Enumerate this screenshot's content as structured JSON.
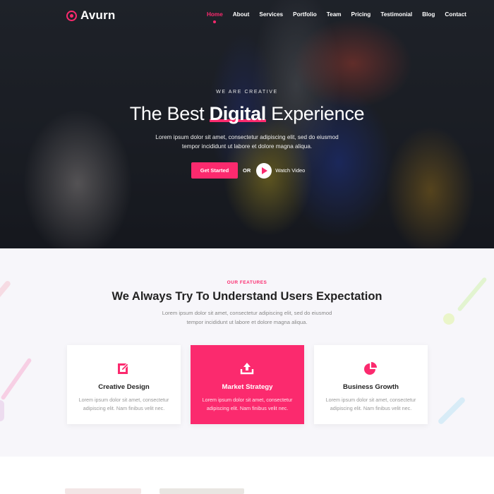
{
  "brand": {
    "name": "Avurn",
    "accent": "#fb2a6e",
    "logo_icon": "circle-target-icon"
  },
  "nav": {
    "items": [
      {
        "label": "Home",
        "active": true
      },
      {
        "label": "About",
        "active": false
      },
      {
        "label": "Services",
        "active": false
      },
      {
        "label": "Portfolio",
        "active": false
      },
      {
        "label": "Team",
        "active": false
      },
      {
        "label": "Pricing",
        "active": false
      },
      {
        "label": "Testimonial",
        "active": false
      },
      {
        "label": "Blog",
        "active": false
      },
      {
        "label": "Contact",
        "active": false
      }
    ]
  },
  "hero": {
    "eyebrow": "WE ARE CREATIVE",
    "title_pre": "The Best ",
    "title_bold": "Digital",
    "title_post": " Experience",
    "description": "Lorem ipsum dolor sit amet, consectetur adipiscing elit, sed do eiusmod tempor incididunt ut labore et dolore magna aliqua.",
    "cta_label": "Get Started",
    "or_label": "OR",
    "video_label": "Watch Video",
    "play_icon": "play-icon"
  },
  "features": {
    "eyebrow": "OUR FEATURES",
    "title_pre": "We Always Try To ",
    "title_bold": "Understand",
    "title_post": " Users Expectation",
    "description": "Lorem ipsum dolor sit amet, consectetur adipiscing elit, sed do eiusmod tempor incididunt ut labore et dolore magna aliqua.",
    "cards": [
      {
        "title": "Creative Design",
        "text": "Lorem ipsum dolor sit amet, consectetur adipiscing elit. Nam finibus velit nec.",
        "icon": "edit-icon",
        "active": false
      },
      {
        "title": "Market Strategy",
        "text": "Lorem ipsum dolor sit amet, consectetur adipiscing elit. Nam finibus velit nec.",
        "icon": "upload-icon",
        "active": true
      },
      {
        "title": "Business Growth",
        "text": "Lorem ipsum dolor sit amet, consectetur adipiscing elit. Nam finibus velit nec.",
        "icon": "pie-chart-icon",
        "active": false
      }
    ]
  }
}
